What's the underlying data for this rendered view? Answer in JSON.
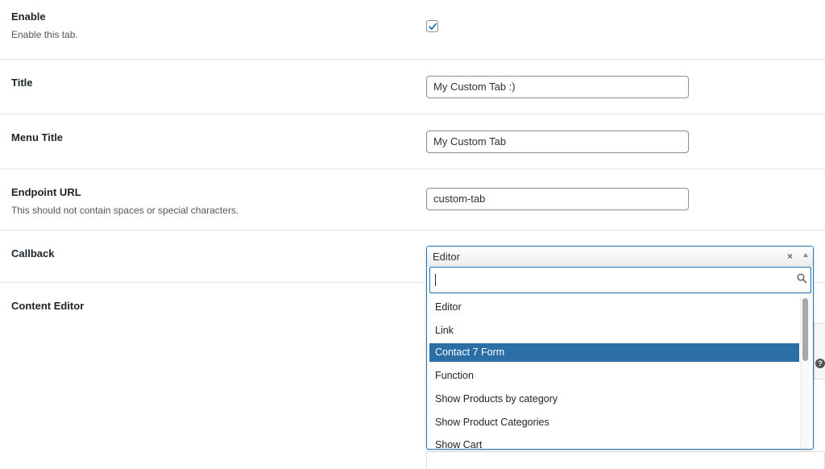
{
  "settings": {
    "enable": {
      "label": "Enable",
      "description": "Enable this tab.",
      "checked": true
    },
    "title": {
      "label": "Title",
      "value": "My Custom Tab :)"
    },
    "menu_title": {
      "label": "Menu Title",
      "value": "My Custom Tab"
    },
    "endpoint": {
      "label": "Endpoint URL",
      "description": "This should not contain spaces or special characters.",
      "value": "custom-tab"
    },
    "callback": {
      "label": "Callback",
      "selected": "Editor",
      "clear_glyph": "×",
      "search_value": "",
      "options": [
        "Editor",
        "Link",
        "Contact 7 Form",
        "Function",
        "Show Products by category",
        "Show Product Categories",
        "Show Cart"
      ],
      "highlighted_option": "Contact 7 Form"
    },
    "content_editor": {
      "label": "Content Editor",
      "help_glyph": "?"
    }
  },
  "colors": {
    "accent": "#2271b1",
    "highlight": "#2c6fa6"
  }
}
